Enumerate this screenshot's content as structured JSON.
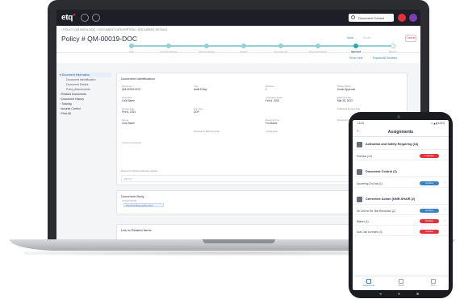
{
  "laptop_app": {
    "logo": "etq",
    "search_placeholder": "Document Control",
    "breadcrumb": "‹ POLICY QM 00019-DOC  ·  DOCUMENT DESCRIPTION  ·  DOCUMENT DETAILS",
    "page_title": "Policy # QM-00019-DOC",
    "header_actions": [
      "Save",
      "Route",
      "Cancel"
    ],
    "workflow_steps": [
      {
        "label": "Draft",
        "state": "done"
      },
      {
        "label": "Document Review",
        "state": "done"
      },
      {
        "label": "Approval Routing",
        "state": "done"
      },
      {
        "label": "Review",
        "state": "done"
      },
      {
        "label": "Final Approval",
        "state": "done"
      },
      {
        "label": "Document Release",
        "state": "done"
      },
      {
        "label": "Approved",
        "state": "active"
      },
      {
        "label": "Effective",
        "state": "pending"
      }
    ],
    "toolbar_links": [
      "Show Hide",
      "Expand All Sections"
    ],
    "sidebar": [
      {
        "label": "▾ Document Information",
        "level": 0,
        "active": true
      },
      {
        "label": "Document Identification",
        "level": 1
      },
      {
        "label": "Document Details",
        "level": 1
      },
      {
        "label": "Policy Attachments",
        "level": 1
      },
      {
        "label": "› Related Documents",
        "level": 0
      },
      {
        "label": "› Document History",
        "level": 0
      },
      {
        "label": "› Training",
        "level": 0
      },
      {
        "label": "› Access Control",
        "level": 0
      },
      {
        "label": "› Print All",
        "level": 0
      }
    ],
    "identification": {
      "title": "Document Identification",
      "fields": [
        {
          "label": "Document",
          "value": "QM-00019-DOC"
        },
        {
          "label": "Title",
          "value": "Audit Policy"
        },
        {
          "label": "Revision",
          "value": "1"
        },
        {
          "label": "Phase Status",
          "value": "Under Approval"
        },
        {
          "label": "Originator",
          "value": "Cole Barrie"
        },
        {
          "label": "",
          "value": ""
        },
        {
          "label": "Origination Date",
          "value": "Feb 6, 2023"
        },
        {
          "label": "Effective Date",
          "value": "Mar 28, 2023"
        },
        {
          "label": "Review Date",
          "value": "Feb 6, 2024"
        },
        {
          "label": "Doc Type",
          "value": "SOP"
        },
        {
          "label": "",
          "value": ""
        },
        {
          "label": "Additional Review Req",
          "value": ""
        },
        {
          "label": "Owner",
          "value": "Cole Barrie"
        },
        {
          "label": "",
          "value": ""
        },
        {
          "label": "Document Co",
          "value": "Fox Barrie"
        },
        {
          "label": "Document Effective Date",
          "value": ""
        },
        {
          "label": "",
          "value": ""
        },
        {
          "label": "Distribution Effective Date",
          "value": ""
        },
        {
          "label": "Configurator",
          "value": ""
        },
        {
          "label": "",
          "value": ""
        },
        {
          "label": "Custom Comments",
          "value": ""
        }
      ],
      "reason_label": "Reason for Revision/Review Update",
      "reason_placeholder": "Add text"
    },
    "documents": {
      "title": "Document Body",
      "input_label": "Upload Details",
      "chip": "Document Body (policy).docx"
    },
    "links": {
      "title": "Link to Related Items"
    }
  },
  "phone_app": {
    "time": "12:30",
    "signal": "▾ ◢ ▮ 100%",
    "title": "Assignments",
    "sections": [
      {
        "title": "Activation and Safety Requiring (16)",
        "icon_color": "#6b6f78",
        "rows": [
          {
            "label": "Overdue (10)",
            "status": "In Review",
            "color": "#e2313b"
          }
        ]
      },
      {
        "title": "Document Control (3)",
        "icon_color": "#6b6f78",
        "rows": [
          {
            "label": "Upcoming On-Hold (1)",
            "status": "Up Next",
            "color": "#3b82c4"
          }
        ]
      },
      {
        "title": "Corrective Action (DMR-SHAIR (2)",
        "icon_color": "#6b6f78",
        "rows": [
          {
            "label": "On Cell for Re-Test Resolution (2)",
            "status": "Up Next",
            "color": "#3b82c4"
          },
          {
            "label": "Waiver (1)",
            "status": "Overdue",
            "color": "#e2313b"
          },
          {
            "label": "Sub Cost to review (3)",
            "status": "Overdue",
            "color": "#e2313b"
          }
        ]
      }
    ],
    "bottom_nav": [
      {
        "label": "Assignments",
        "active": true
      },
      {
        "label": "Search",
        "active": false
      },
      {
        "label": "More",
        "active": false
      }
    ]
  }
}
